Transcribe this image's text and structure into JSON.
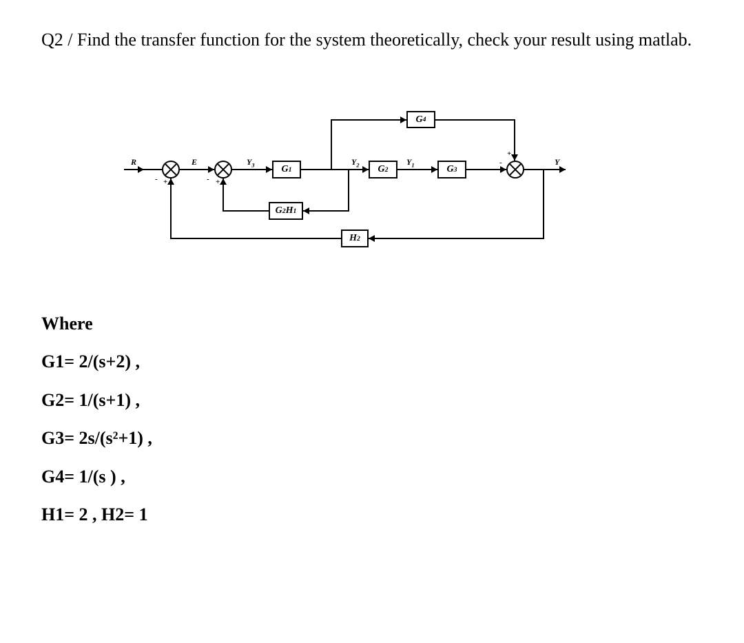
{
  "question": {
    "prefix": "Q2 / ",
    "text": "Find the transfer function for the system theoretically, check your result using matlab."
  },
  "diagram": {
    "signals": {
      "R": "R",
      "E": "E",
      "Y3": "Y₃",
      "Y2": "Y₂",
      "Y1": "Y₁",
      "Y": "Y"
    },
    "blocks": {
      "G1": "G₁",
      "G2": "G₂",
      "G3": "G₃",
      "G4": "G₄",
      "G2H1": "G₂H₁",
      "H2": "H₂"
    },
    "signs": {
      "plus": "+",
      "minus": "-"
    }
  },
  "where": {
    "heading": "Where",
    "equations": [
      "G1= 2/(s+2) ,",
      "G2= 1/(s+1) ,",
      "G3= 2s/(s²+1) ,",
      "G4= 1/(s ) ,",
      "H1= 2  , H2= 1"
    ]
  }
}
